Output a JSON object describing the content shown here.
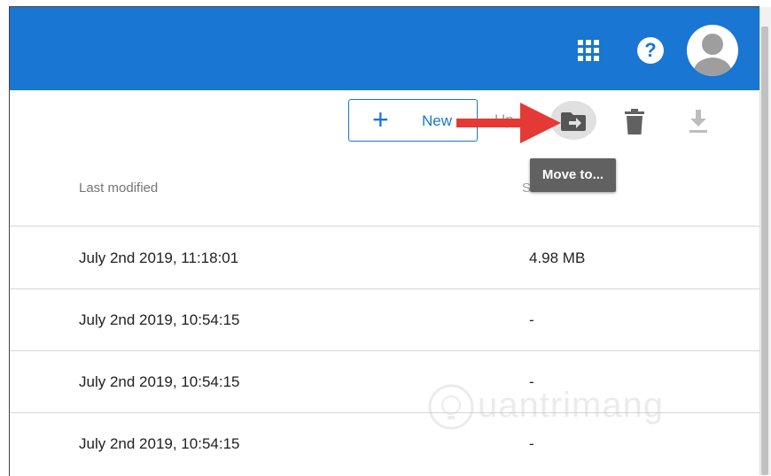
{
  "toolbar": {
    "new_label": "New",
    "partial_label": "Up",
    "tooltip": "Move to..."
  },
  "table": {
    "headers": {
      "last_modified": "Last modified",
      "size": "Size"
    },
    "rows": [
      {
        "date": "July 2nd 2019, 11:18:01",
        "size": "4.98 MB"
      },
      {
        "date": "July 2nd 2019, 10:54:15",
        "size": "-"
      },
      {
        "date": "July 2nd 2019, 10:54:15",
        "size": "-"
      },
      {
        "date": "July 2nd 2019, 10:54:15",
        "size": "-"
      }
    ]
  },
  "watermark": {
    "text": "uantrimang"
  },
  "colors": {
    "appbar": "#1976d2",
    "arrow": "#e53935",
    "tooltip": "#616161"
  },
  "icons": [
    "apps-icon",
    "help-icon",
    "avatar",
    "plus-icon",
    "move-to-icon",
    "trash-icon",
    "download-icon"
  ]
}
